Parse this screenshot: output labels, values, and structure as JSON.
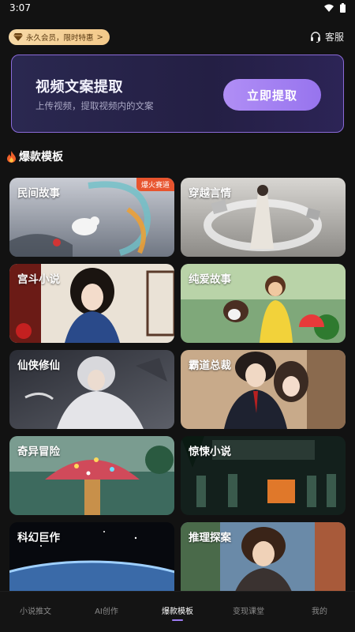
{
  "status_bar": {
    "time": "3:07"
  },
  "vip": {
    "label": "永久会员，限时特惠",
    "chevron": ">"
  },
  "service": {
    "label": "客服"
  },
  "banner": {
    "title": "视频文案提取",
    "subtitle": "上传视频，提取视频内的文案",
    "button": "立即提取"
  },
  "section": {
    "title": "爆款模板"
  },
  "cards": [
    {
      "label": "民间故事",
      "badge": "爆火赛道"
    },
    {
      "label": "穿越言情"
    },
    {
      "label": "宫斗小说"
    },
    {
      "label": "纯爱故事"
    },
    {
      "label": "仙侠修仙"
    },
    {
      "label": "霸道总裁"
    },
    {
      "label": "奇异冒险"
    },
    {
      "label": "惊悚小说"
    },
    {
      "label": "科幻巨作"
    },
    {
      "label": "推理探案"
    }
  ],
  "tabs": [
    {
      "label": "小说推文"
    },
    {
      "label": "AI创作"
    },
    {
      "label": "爆款模板"
    },
    {
      "label": "变现课堂"
    },
    {
      "label": "我的"
    }
  ],
  "colors": {
    "accent": "#9d7cf2",
    "badge": "#e8542e",
    "vip": "#f3c98a"
  }
}
